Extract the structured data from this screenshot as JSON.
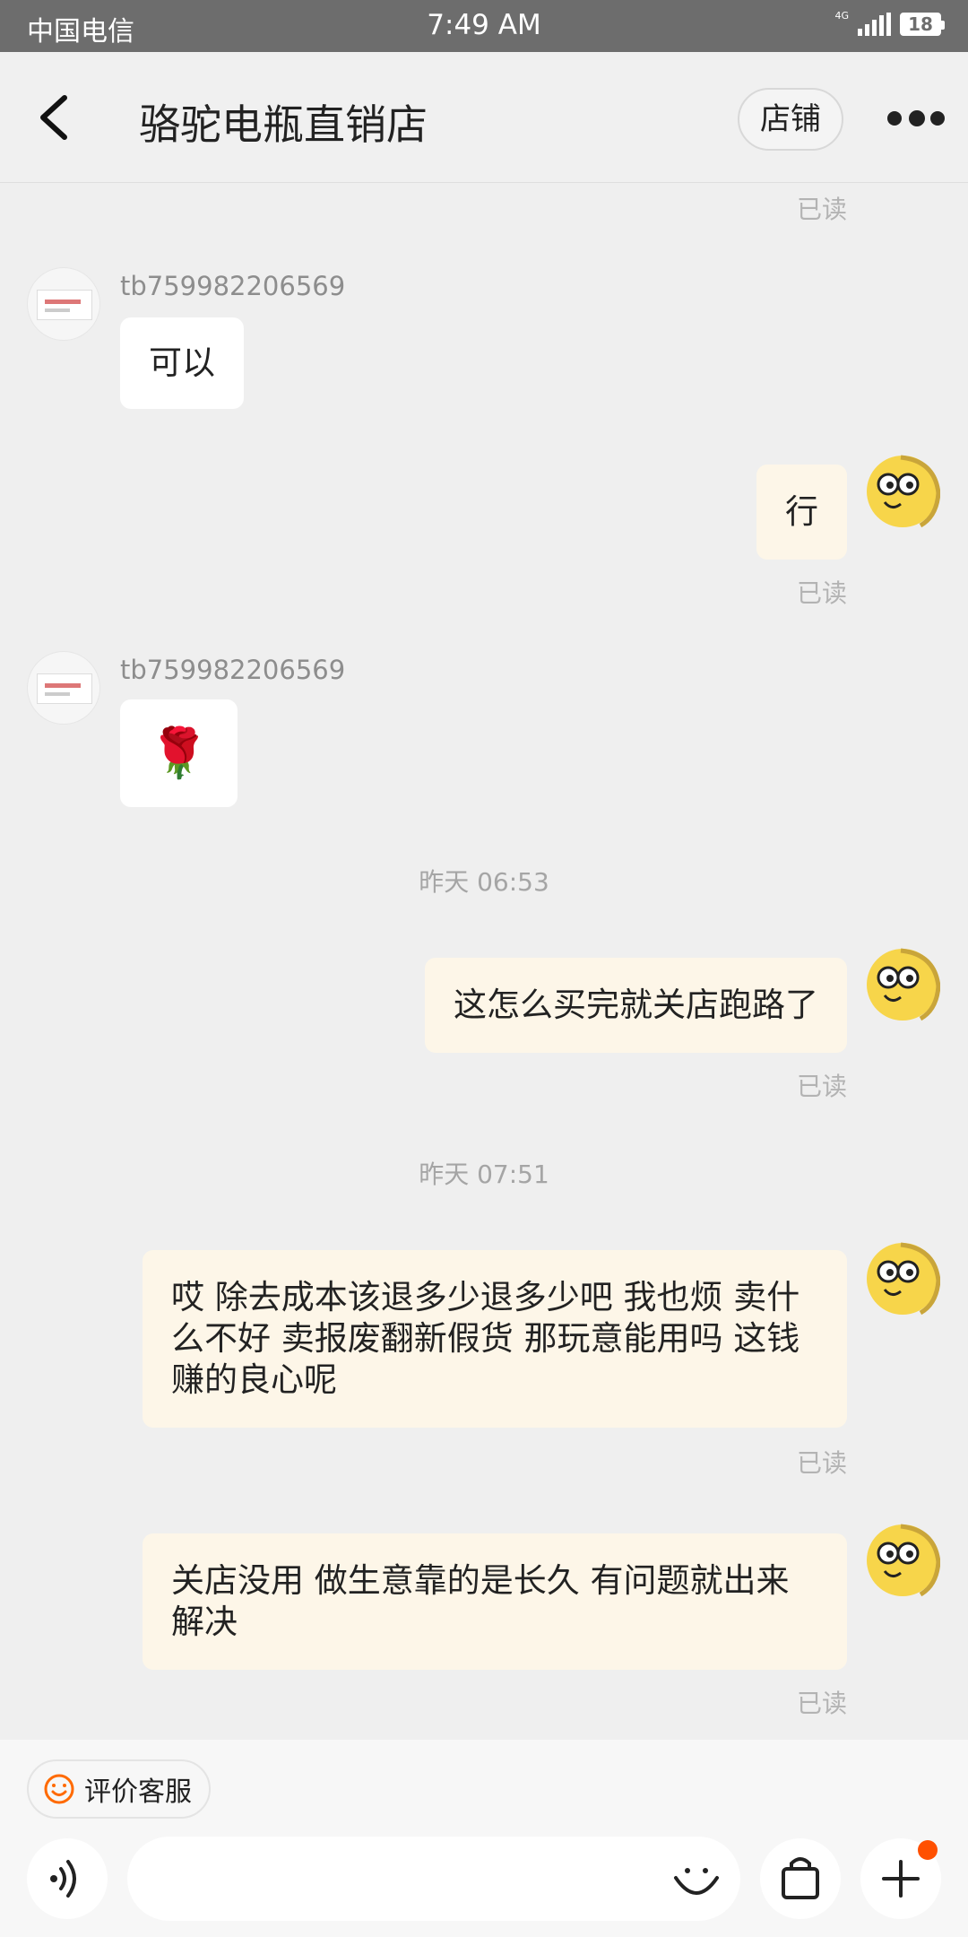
{
  "status_bar": {
    "carrier": "中国电信",
    "time": "7:49 AM",
    "network": "4G",
    "battery": "18"
  },
  "header": {
    "title": "骆驼电瓶直销店",
    "shop_label": "店铺"
  },
  "read_label": "已读",
  "shop_nickname": "tb759982206569",
  "messages": {
    "m1": "可以",
    "m2": "行",
    "m3": "🌹",
    "m4": "这怎么买完就关店跑路了",
    "m5": "哎 除去成本该退多少退多少吧  我也烦 卖什么不好 卖报废翻新假货 那玩意能用吗 这钱赚的良心呢",
    "m6": "关店没用 做生意靠的是长久 有问题就出来解决"
  },
  "timestamps": {
    "t1": "昨天  06:53",
    "t2": "昨天  07:51"
  },
  "bottom": {
    "rate_label": "评价客服",
    "input_placeholder": ""
  },
  "colors": {
    "accent": "#ff5000",
    "bubble_out": "#fdf6e8",
    "bubble_in": "#ffffff",
    "background": "#efefef"
  }
}
